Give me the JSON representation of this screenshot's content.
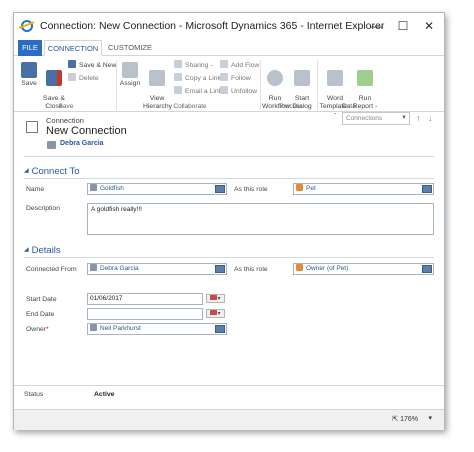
{
  "window": {
    "title": "Connection: New Connection - Microsoft Dynamics 365 - Internet Explorer"
  },
  "window_controls": {
    "minimize": "—",
    "maximize": "☐",
    "close": "✕"
  },
  "ribbon_tabs": [
    {
      "label": "FILE"
    },
    {
      "label": "CONNECTION"
    },
    {
      "label": "CUSTOMIZE"
    }
  ],
  "ribbon": {
    "save": {
      "label": "Save",
      "icon": "save-icon"
    },
    "save_close": {
      "label": "Save &\nClose",
      "icon": "save-close-icon"
    },
    "save_new": {
      "label": "Save & New",
      "icon": "save-new-icon"
    },
    "delete": {
      "label": "Delete",
      "icon": "delete-icon"
    },
    "assign": {
      "label": "Assign",
      "icon": "assign-icon"
    },
    "view_hierarchy": {
      "label": "View\nHierarchy",
      "icon": "hierarchy-icon"
    },
    "sharing": {
      "label": "Sharing -",
      "icon": "share-icon"
    },
    "copy_link": {
      "label": "Copy a Link",
      "icon": "link-icon"
    },
    "email_link": {
      "label": "Email a Link",
      "icon": "email-icon"
    },
    "add_flow": {
      "label": "Add Flow",
      "icon": "add-flow-icon"
    },
    "follow": {
      "label": "Follow",
      "icon": "follow-icon"
    },
    "unfollow": {
      "label": "Unfollow",
      "icon": "unfollow-icon"
    },
    "run_workflow": {
      "label": "Run\nWorkflow",
      "icon": "workflow-icon"
    },
    "start_dialog": {
      "label": "Start\nDialog",
      "icon": "dialog-icon"
    },
    "word_templates": {
      "label": "Word\nTemplates -",
      "icon": "word-icon"
    },
    "run_report": {
      "label": "Run\nReport -",
      "icon": "report-icon"
    },
    "groups": {
      "save": "Save",
      "collaborate": "Collaborate",
      "process": "Process",
      "data": "Data"
    }
  },
  "record": {
    "type": "Connection",
    "name": "New Connection",
    "owner": "Debra Garcia"
  },
  "form_selector": {
    "value": "Connections"
  },
  "sections": {
    "connect_to": "Connect To",
    "details": "Details"
  },
  "fields": {
    "name": {
      "label": "Name",
      "value": "Goldfish"
    },
    "as_role_1": {
      "label": "As this role",
      "value": "Pet"
    },
    "description": {
      "label": "Description",
      "value": "A goldfish really!!!"
    },
    "connected_from": {
      "label": "Connected From",
      "value": "Debra Garcia"
    },
    "as_role_2": {
      "label": "As this role",
      "value": "Owner (of Pet)"
    },
    "start_date": {
      "label": "Start Date",
      "value": "01/06/2017"
    },
    "end_date": {
      "label": "End Date",
      "value": ""
    },
    "owner": {
      "label": "Owner",
      "required": "*",
      "value": "Neil Parkhurst"
    }
  },
  "footer": {
    "status_label": "Status",
    "status_value": "Active"
  },
  "statusbar": {
    "zoom": "176%",
    "zoom_arrow": "▾"
  }
}
